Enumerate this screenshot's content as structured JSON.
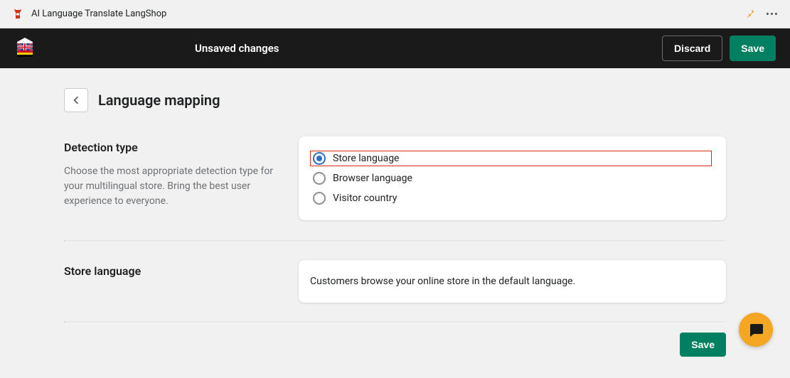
{
  "top_strip": {
    "app_name": "AI Language Translate LangShop"
  },
  "header_bar": {
    "status_text": "Unsaved changes",
    "discard_label": "Discard",
    "save_label": "Save"
  },
  "page": {
    "title": "Language mapping",
    "sections": {
      "detection": {
        "title": "Detection type",
        "description": "Choose the most appropriate detection type for your multilingual store. Bring the best user experience to everyone.",
        "options": [
          {
            "label": "Store language",
            "selected": true,
            "highlighted": true
          },
          {
            "label": "Browser language",
            "selected": false,
            "highlighted": false
          },
          {
            "label": "Visitor country",
            "selected": false,
            "highlighted": false
          }
        ]
      },
      "store_language": {
        "title": "Store language",
        "info": "Customers browse your online store in the default language."
      }
    },
    "footer_save_label": "Save"
  }
}
